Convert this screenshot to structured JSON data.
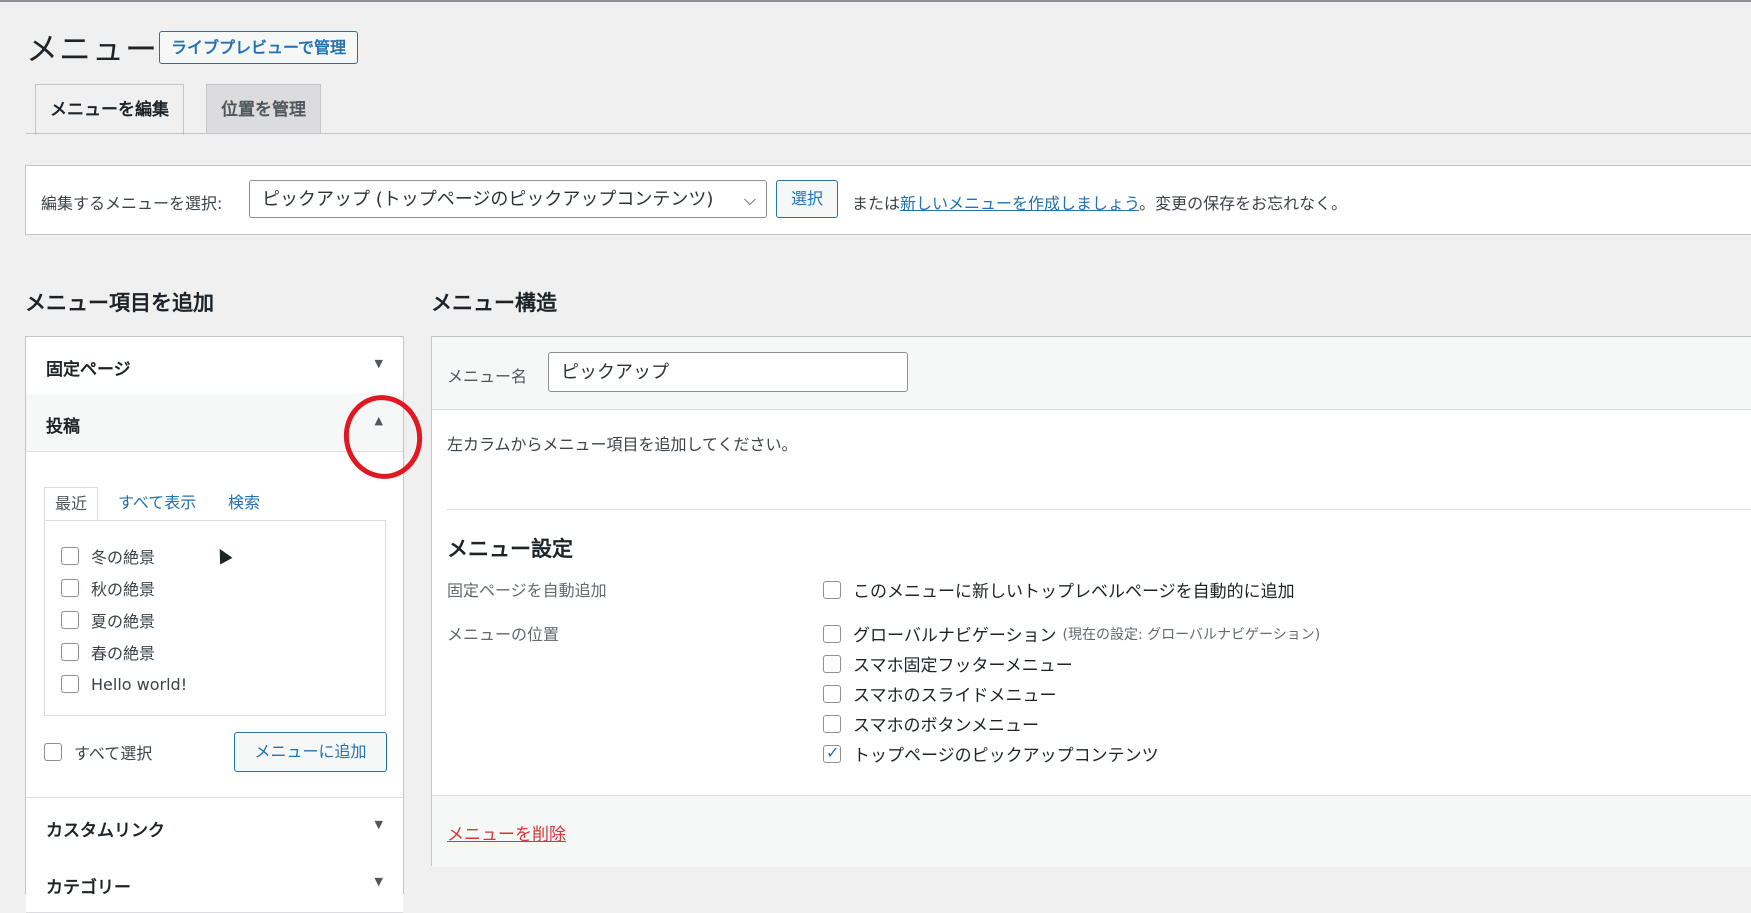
{
  "header": {
    "title": "メニュー",
    "live_preview_button": "ライブプレビューで管理"
  },
  "tabs": [
    {
      "label": "メニューを編集",
      "active": true
    },
    {
      "label": "位置を管理",
      "active": false
    }
  ],
  "select_bar": {
    "label": "編集するメニューを選択:",
    "selected_menu": "ピックアップ (トップページのピックアップコンテンツ)",
    "select_button": "選択",
    "or_text": "または",
    "create_link": "新しいメニューを作成しましょう",
    "suffix": "。変更の保存をお忘れなく。"
  },
  "add_items": {
    "heading": "メニュー項目を追加",
    "sections": {
      "pages": "固定ページ",
      "posts": "投稿",
      "custom_links": "カスタムリンク",
      "categories": "カテゴリー"
    },
    "post_tabs": [
      "最近",
      "すべて表示",
      "検索"
    ],
    "posts": [
      "冬の絶景",
      "秋の絶景",
      "夏の絶景",
      "春の絶景",
      "Hello world!"
    ],
    "select_all": "すべて選択",
    "add_to_menu": "メニューに追加"
  },
  "structure": {
    "heading": "メニュー構造",
    "menu_name_label": "メニュー名",
    "menu_name_value": "ピックアップ",
    "instructions": "左カラムからメニュー項目を追加してください。",
    "settings_heading": "メニュー設定",
    "auto_add_label": "固定ページを自動追加",
    "auto_add_option": "このメニューに新しいトップレベルページを自動的に追加",
    "locations_label": "メニューの位置",
    "locations": [
      {
        "label": "グローバルナビゲーション",
        "note": "(現在の設定: グローバルナビゲーション)",
        "checked": false
      },
      {
        "label": "スマホ固定フッターメニュー",
        "note": "",
        "checked": false
      },
      {
        "label": "スマホのスライドメニュー",
        "note": "",
        "checked": false
      },
      {
        "label": "スマホのボタンメニュー",
        "note": "",
        "checked": false
      },
      {
        "label": "トップページのピックアップコンテンツ",
        "note": "",
        "checked": true
      }
    ],
    "delete_link": "メニューを削除"
  },
  "icons": {
    "arrow_down": "triangle-down-icon",
    "arrow_up": "triangle-up-icon",
    "chevron": "chevron-down-icon"
  }
}
